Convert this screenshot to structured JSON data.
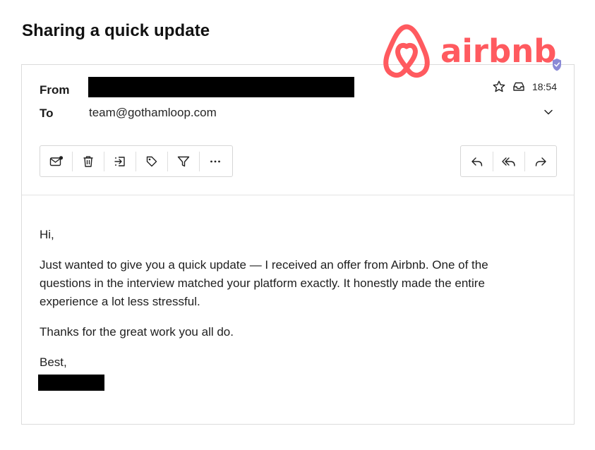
{
  "email": {
    "subject": "Sharing a quick update",
    "from_label": "From",
    "to_label": "To",
    "to_address": "team@gothamloop.com",
    "time": "18:54"
  },
  "brand": {
    "name": "airbnb",
    "color": "#ff5a5f",
    "badge_color": "#8a8ad6",
    "badge_icon": "verified-check-icon"
  },
  "toolbar": {
    "left": [
      "mark-unread-icon",
      "delete-icon",
      "move-icon",
      "tag-icon",
      "filter-icon",
      "more-icon"
    ],
    "right": [
      "reply-icon",
      "reply-all-icon",
      "forward-icon"
    ]
  },
  "body": {
    "greeting": "Hi,",
    "paragraph1": "Just wanted to give you a quick update — I received an offer from Airbnb. One of the questions in the interview matched your platform exactly. It honestly made the entire experience a lot less stressful.",
    "paragraph2": "Thanks for the great work you all do.",
    "closing": "Best,"
  },
  "colors": {
    "border": "#dcdcdc",
    "text": "#1f1f1f",
    "redaction": "#000000"
  }
}
